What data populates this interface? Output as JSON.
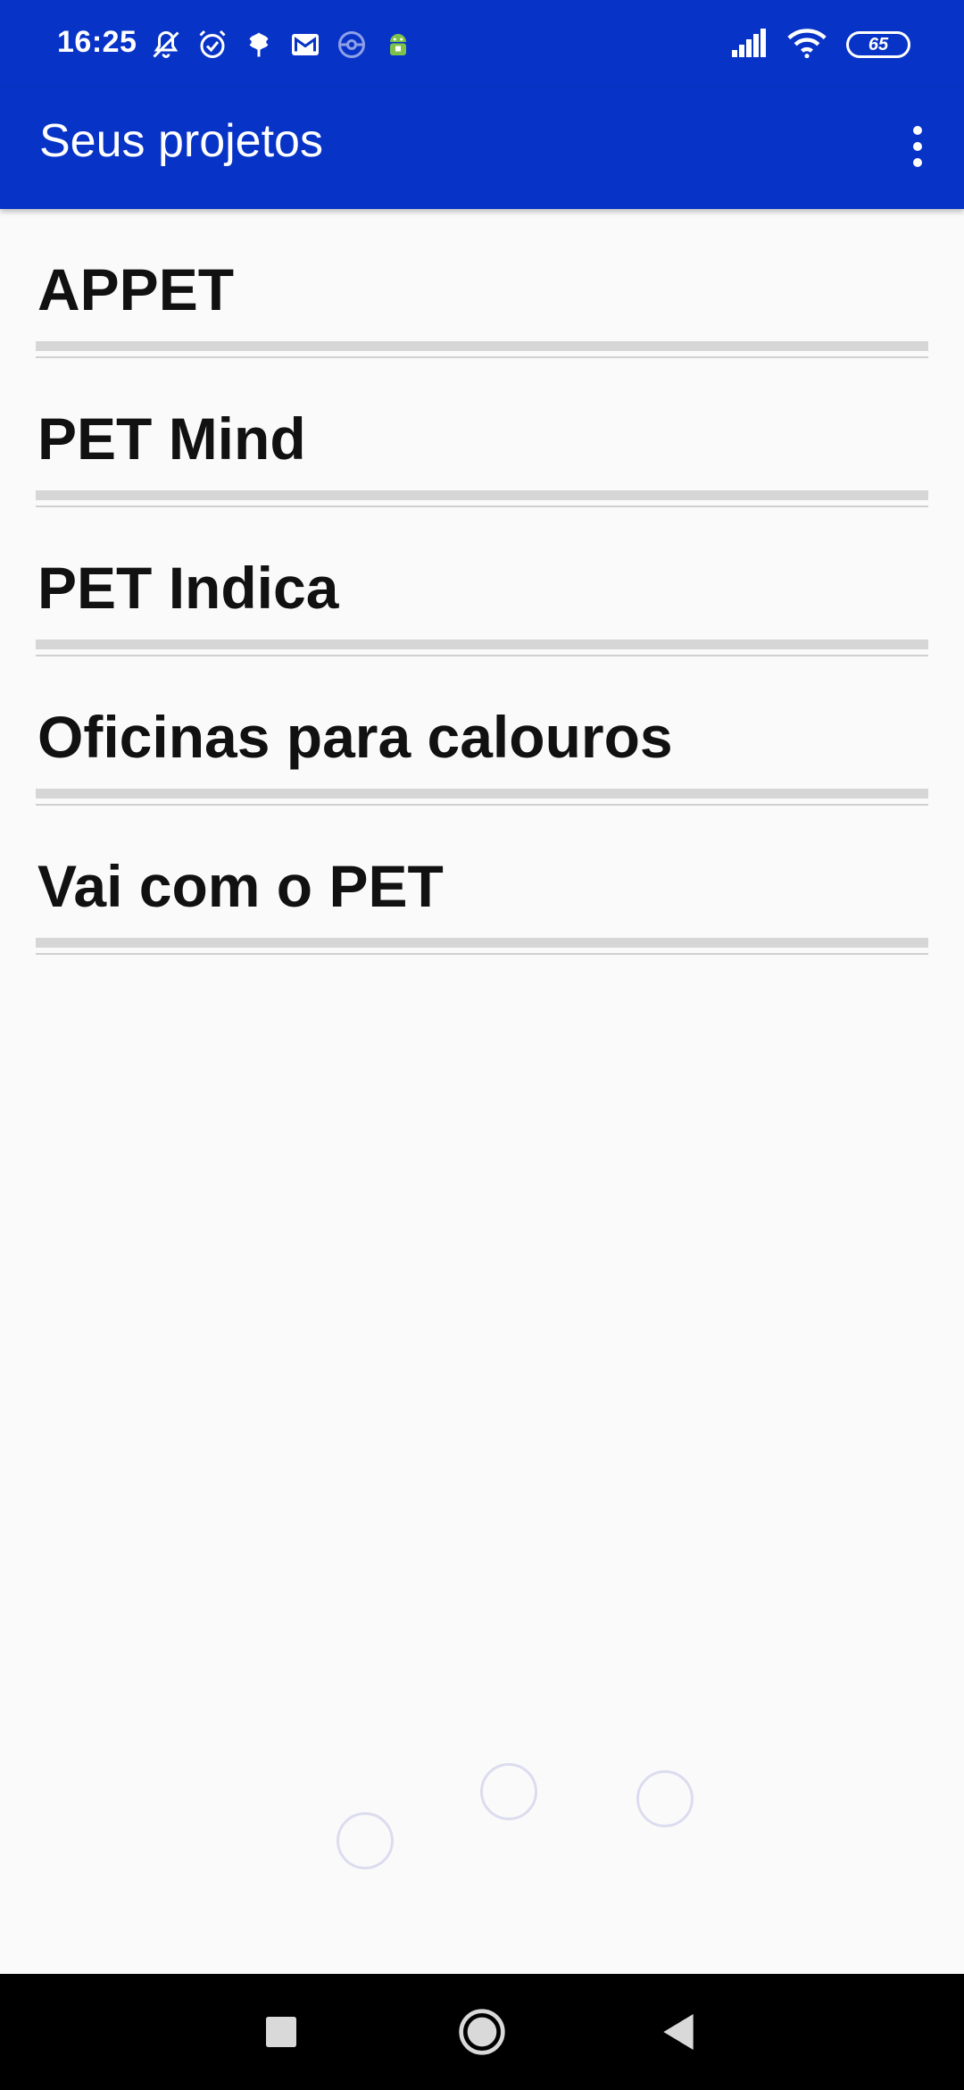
{
  "status_bar": {
    "time": "16:25",
    "battery": "65",
    "left_icons": [
      "bell-off-icon",
      "alarm-icon",
      "leaf-icon",
      "gmail-icon",
      "pokeball-icon",
      "android-icon"
    ],
    "right_icons": [
      "signal-icon",
      "wifi-icon",
      "battery-icon"
    ]
  },
  "app_bar": {
    "title": "Seus projetos",
    "menu_icon": "more-vert-icon"
  },
  "projects": [
    {
      "label": "APPET"
    },
    {
      "label": "PET Mind"
    },
    {
      "label": "PET Indica"
    },
    {
      "label": "Oficinas para calouros"
    },
    {
      "label": "Vai com o PET"
    }
  ],
  "colors": {
    "primary": "#0833c7",
    "background": "#fafafa",
    "text": "#111111",
    "divider": "#d6d6d6"
  },
  "nav_bar": {
    "buttons": [
      "recents-icon",
      "home-icon",
      "back-icon"
    ]
  }
}
